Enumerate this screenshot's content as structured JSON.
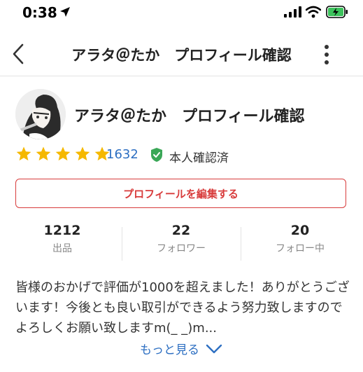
{
  "status_bar": {
    "time": "0:38"
  },
  "nav": {
    "title": "アラタ＠たか　プロフィール確認"
  },
  "profile": {
    "name": "アラタ＠たか　プロフィール確認",
    "rating_stars": 5,
    "rating_count": "1632",
    "verified_label": "本人確認済"
  },
  "edit_button_label": "プロフィールを編集する",
  "stats": [
    {
      "value": "1212",
      "label": "出品"
    },
    {
      "value": "22",
      "label": "フォロワー"
    },
    {
      "value": "20",
      "label": "フォロー中"
    }
  ],
  "bio": {
    "text": "皆様のおかげで評価が1000を超えました！ありがとうございます！今後とも良い取引ができるよう努力致しますのでよろしくお願い致しますm(_ _)m...",
    "more_label": "もっと見る"
  },
  "colors": {
    "accent_red": "#d83c3c",
    "link_blue": "#2d6fc2",
    "star": "#f5b800",
    "verified_green": "#3aa757"
  }
}
